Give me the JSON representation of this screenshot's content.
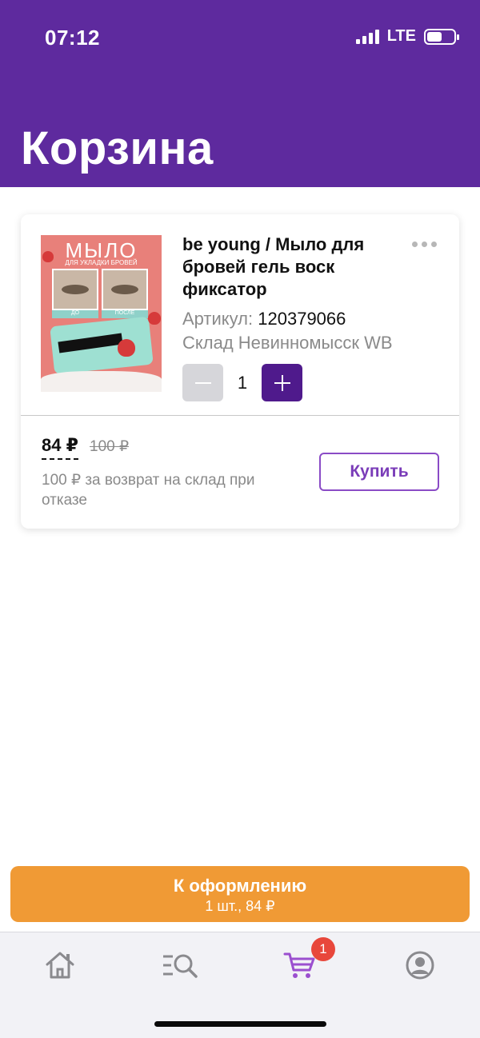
{
  "status_bar": {
    "time": "07:12",
    "network": "LTE"
  },
  "header": {
    "title": "Корзина"
  },
  "cart_item": {
    "image_text": {
      "title": "МЫЛО",
      "subtitle": "ДЛЯ УКЛАДКИ БРОВЕЙ",
      "before": "ДО",
      "after": "ПОСЛЕ"
    },
    "name": "be young / Мыло для бровей гель воск фиксатор",
    "article_label": "Артикул:",
    "article_value": "120379066",
    "warehouse": "Склад Невинномысск WB",
    "quantity": "1",
    "price": "84 ₽",
    "old_price": "100 ₽",
    "return_note": "100 ₽ за возврат на склад при отказе",
    "buy_label": "Купить"
  },
  "checkout": {
    "title": "К оформлению",
    "subtitle": "1 шт., 84 ₽"
  },
  "tabbar": {
    "items": [
      {
        "icon": "home-icon",
        "active": false
      },
      {
        "icon": "catalog-search-icon",
        "active": false
      },
      {
        "icon": "cart-icon",
        "active": true
      },
      {
        "icon": "profile-icon",
        "active": false
      }
    ],
    "cart_badge": "1"
  },
  "colors": {
    "header": "#5e2a9e",
    "accent": "#4f1a8c",
    "checkout": "#f09a35",
    "badge": "#e8473b",
    "tab_active": "#9b4fcf",
    "tab_inactive": "#8a8a8e"
  }
}
